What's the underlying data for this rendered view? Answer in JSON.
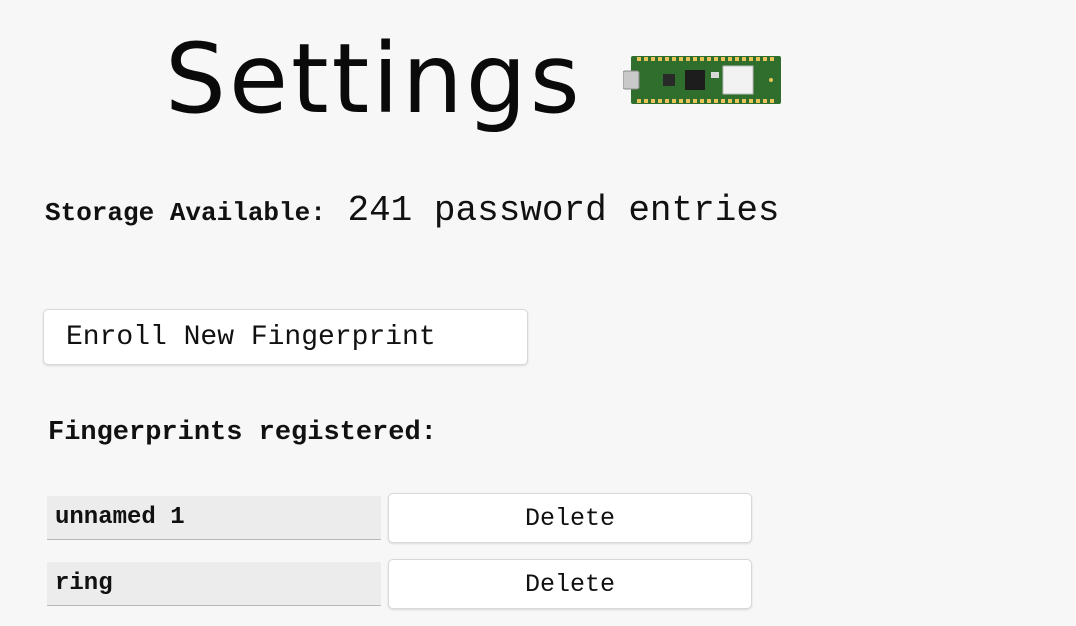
{
  "header": {
    "title": "Settings",
    "board_icon": "pico-board-icon"
  },
  "storage": {
    "label": "Storage Available:",
    "value": "241 password entries"
  },
  "enroll_button": {
    "label": "Enroll New Fingerprint"
  },
  "fingerprints": {
    "heading": "Fingerprints registered:",
    "items": [
      {
        "name": "unnamed 1",
        "delete_label": "Delete"
      },
      {
        "name": "ring",
        "delete_label": "Delete"
      }
    ]
  },
  "colors": {
    "background": "#f7f7f7",
    "board_green": "#2f6e2c",
    "button_bg": "#ffffff",
    "name_field_bg": "#ececec"
  }
}
